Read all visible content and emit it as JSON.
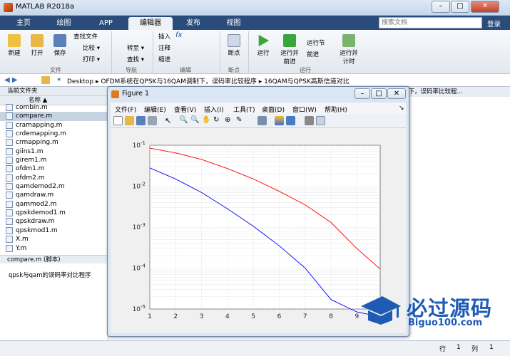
{
  "app": {
    "title": "MATLAB R2018a",
    "login": "登录"
  },
  "tabs": [
    "主页",
    "绘图",
    "APP",
    "编辑器",
    "发布",
    "视图"
  ],
  "search": {
    "placeholder": "搜索文档"
  },
  "ribbon": {
    "new": "新建",
    "open": "打开",
    "save": "保存",
    "find_files": "查找文件",
    "compare": "比较",
    "print": "打印",
    "goto": "转至",
    "find": "查找",
    "insert": "插入",
    "comment": "注释",
    "indent": "缩进",
    "breakpoints": "断点",
    "run": "运行",
    "run_advance": "运行并前进",
    "run_section": "运行节",
    "advance": "前进",
    "run_time": "运行并计时",
    "sections": {
      "file": "文件",
      "nav": "导航",
      "edit": "编辑",
      "bp": "断点",
      "run": "运行"
    }
  },
  "address": {
    "path": "Desktop  ▸  OFDM系统在QPSK与16QAM调制下，误码率比较程序  ▸  16QAM与QPSK高斯信道对比"
  },
  "leftpane": {
    "title": "当前文件夹",
    "col_name": "名称 ▲",
    "files": [
      "combin.m",
      "compare.m",
      "cramapping.m",
      "crdemapping.m",
      "crmapping.m",
      "giins1.m",
      "girem1.m",
      "ofdm1.m",
      "ofdm2.m",
      "qamdemod2.m",
      "qamdraw.m",
      "qammod2.m",
      "qpskdemod1.m",
      "qpskdraw.m",
      "qpskmod1.m",
      "X.m",
      "Y.m"
    ],
    "selected": "compare.m",
    "details_title": "compare.m  (脚本)",
    "details_text": "qpsk与qam的误码率对比程序"
  },
  "rightpane": {
    "title": "制下，误码率比较程..."
  },
  "status": {
    "row_label": "行",
    "row": "1",
    "col_label": "列",
    "col": "1"
  },
  "figure": {
    "title": "Figure 1",
    "menus": [
      "文件(F)",
      "编辑(E)",
      "查看(V)",
      "插入(I)",
      "工具(T)",
      "桌面(D)",
      "窗口(W)",
      "帮助(H)"
    ]
  },
  "watermark": {
    "line1": "必过源码",
    "line2": "Biguo100.com"
  },
  "chart_data": {
    "type": "line",
    "yscale": "log",
    "xlim": [
      1,
      9.9
    ],
    "ylim": [
      1e-05,
      0.1
    ],
    "xticks": [
      "1",
      "2",
      "3",
      "4",
      "5",
      "6",
      "7",
      "8",
      "9"
    ],
    "yticks": [
      "10^-5",
      "10^-4",
      "10^-3",
      "10^-2",
      "10^-1"
    ],
    "grid": true,
    "series": [
      {
        "color": "#ff0000",
        "x": [
          1,
          2,
          3,
          4,
          5,
          6,
          7,
          8,
          9,
          9.9
        ],
        "y": [
          0.085,
          0.065,
          0.045,
          0.027,
          0.015,
          0.0075,
          0.0035,
          0.0013,
          0.0003,
          9.5e-05
        ]
      },
      {
        "color": "#0000ff",
        "x": [
          1,
          2,
          3,
          4,
          5,
          6,
          7,
          8,
          9,
          9.9
        ],
        "y": [
          0.028,
          0.015,
          0.007,
          0.0028,
          0.00105,
          0.00035,
          0.0001,
          1.7e-05,
          8.5e-06,
          6.5e-06
        ]
      }
    ]
  }
}
